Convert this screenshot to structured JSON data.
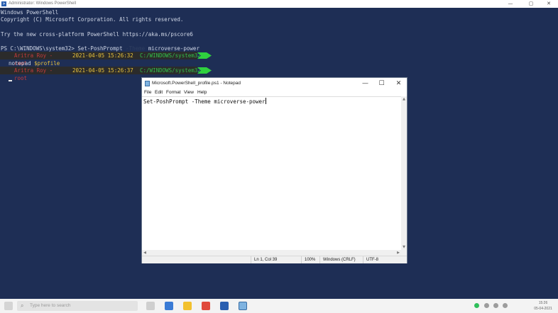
{
  "powershell": {
    "title": "Administrator: Windows PowerShell",
    "controls": {
      "minimize": "—",
      "maximize": "▢",
      "close": "✕"
    },
    "lines": {
      "header1": "Windows PowerShell",
      "header2": "Copyright (C) Microsoft Corporation. All rights reserved.",
      "header3": "Try the new cross-platform PowerShell https://aka.ms/pscore6",
      "cmd_prompt": "PS C:\\WINDOWS\\system32> Set-PoshPrompt ",
      "cmd_flag": "-Theme",
      "cmd_arg": " microverse-power",
      "notepad_cmd": "notepad",
      "notepad_arg": " $profile"
    },
    "prompts": [
      {
        "user": "Aritra Roy - root",
        "date": "2021-04-05 15:26:32",
        "path": "C:/WINDOWS/system32"
      },
      {
        "user": "Aritra Roy - root",
        "date": "2021-04-05 15:26:37",
        "path": "C:/WINDOWS/system32"
      }
    ],
    "colors": {
      "background": "#1e2e55",
      "user": "#c33b3b",
      "date": "#e9c23b",
      "path": "#32c04a",
      "arrow": "#2fd13f"
    }
  },
  "notepad": {
    "title": "Microsoft.PowerShell_profile.ps1 - Notepad",
    "controls": {
      "minimize": "—",
      "maximize": "☐",
      "close": "✕"
    },
    "menu": {
      "file": "File",
      "edit": "Edit",
      "format": "Format",
      "view": "View",
      "help": "Help"
    },
    "content": "Set-PoshPrompt -Theme microverse-power",
    "status": {
      "position": "Ln 1, Col 39",
      "zoom": "100%",
      "line_ending": "Windows (CRLF)",
      "encoding": "UTF-8"
    }
  },
  "taskbar": {
    "search_placeholder": "Type here to search",
    "search_icon": "search-icon",
    "time": "15:26",
    "date": "05-04-2021"
  }
}
